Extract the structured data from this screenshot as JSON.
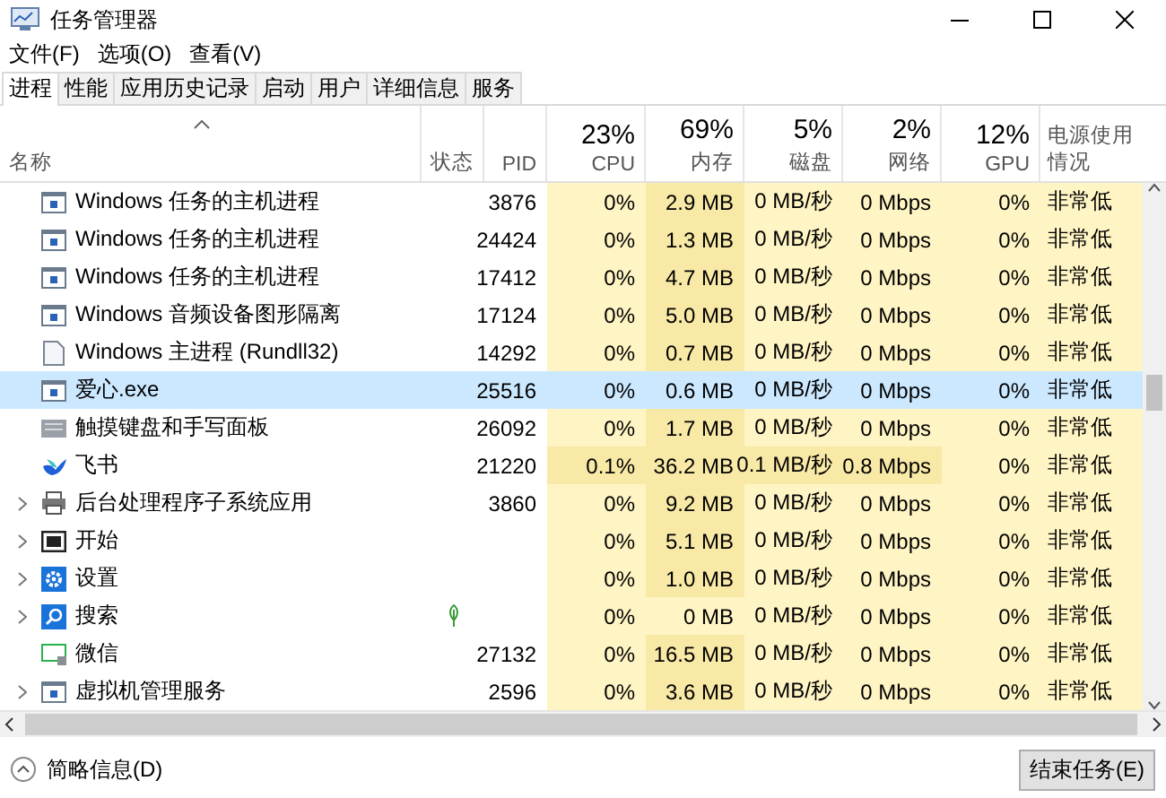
{
  "window": {
    "title": "任务管理器"
  },
  "menu": [
    "文件(F)",
    "选项(O)",
    "查看(V)"
  ],
  "tabs": [
    {
      "label": "进程",
      "selected": true
    },
    {
      "label": "性能",
      "selected": false
    },
    {
      "label": "应用历史记录",
      "selected": false
    },
    {
      "label": "启动",
      "selected": false
    },
    {
      "label": "用户",
      "selected": false
    },
    {
      "label": "详细信息",
      "selected": false
    },
    {
      "label": "服务",
      "selected": false
    }
  ],
  "table": {
    "columns": [
      {
        "kind": "name",
        "label": "名称"
      },
      {
        "kind": "text",
        "label": "状态"
      },
      {
        "kind": "text",
        "label": "PID"
      },
      {
        "kind": "usage",
        "label": "CPU",
        "usage": "23%"
      },
      {
        "kind": "usage",
        "label": "内存",
        "usage": "69%"
      },
      {
        "kind": "usage",
        "label": "磁盘",
        "usage": "5%"
      },
      {
        "kind": "usage",
        "label": "网络",
        "usage": "2%"
      },
      {
        "kind": "usage",
        "label": "GPU",
        "usage": "12%"
      },
      {
        "kind": "left",
        "label": "电源使用情况"
      }
    ],
    "rows": [
      {
        "kind": "app",
        "expandable": false,
        "selected": false,
        "eco": false,
        "cells": [
          {
            "text": "Windows 任务的主机进程"
          },
          {
            "text": ""
          },
          {
            "text": "3876"
          },
          {
            "text": "0%",
            "hot": false
          },
          {
            "text": "2.9 MB",
            "hot": true
          },
          {
            "text": "0 MB/秒",
            "hot": false
          },
          {
            "text": "0 Mbps",
            "hot": false
          },
          {
            "text": "0%",
            "hot": false
          },
          {
            "text": "非常低",
            "hot": false
          }
        ]
      },
      {
        "kind": "app",
        "expandable": false,
        "selected": false,
        "eco": false,
        "cells": [
          {
            "text": "Windows 任务的主机进程"
          },
          {
            "text": ""
          },
          {
            "text": "24424"
          },
          {
            "text": "0%",
            "hot": false
          },
          {
            "text": "1.3 MB",
            "hot": true
          },
          {
            "text": "0 MB/秒",
            "hot": false
          },
          {
            "text": "0 Mbps",
            "hot": false
          },
          {
            "text": "0%",
            "hot": false
          },
          {
            "text": "非常低",
            "hot": false
          }
        ]
      },
      {
        "kind": "app",
        "expandable": false,
        "selected": false,
        "eco": false,
        "cells": [
          {
            "text": "Windows 任务的主机进程"
          },
          {
            "text": ""
          },
          {
            "text": "17412"
          },
          {
            "text": "0%",
            "hot": false
          },
          {
            "text": "4.7 MB",
            "hot": true
          },
          {
            "text": "0 MB/秒",
            "hot": false
          },
          {
            "text": "0 Mbps",
            "hot": false
          },
          {
            "text": "0%",
            "hot": false
          },
          {
            "text": "非常低",
            "hot": false
          }
        ]
      },
      {
        "kind": "app",
        "expandable": false,
        "selected": false,
        "eco": false,
        "cells": [
          {
            "text": "Windows 音频设备图形隔离"
          },
          {
            "text": ""
          },
          {
            "text": "17124"
          },
          {
            "text": "0%",
            "hot": false
          },
          {
            "text": "5.0 MB",
            "hot": true
          },
          {
            "text": "0 MB/秒",
            "hot": false
          },
          {
            "text": "0 Mbps",
            "hot": false
          },
          {
            "text": "0%",
            "hot": false
          },
          {
            "text": "非常低",
            "hot": false
          }
        ]
      },
      {
        "kind": "document",
        "expandable": false,
        "selected": false,
        "eco": false,
        "cells": [
          {
            "text": "Windows 主进程 (Rundll32)"
          },
          {
            "text": ""
          },
          {
            "text": "14292"
          },
          {
            "text": "0%",
            "hot": false
          },
          {
            "text": "0.7 MB",
            "hot": true
          },
          {
            "text": "0 MB/秒",
            "hot": false
          },
          {
            "text": "0 Mbps",
            "hot": false
          },
          {
            "text": "0%",
            "hot": false
          },
          {
            "text": "非常低",
            "hot": false
          }
        ]
      },
      {
        "kind": "app",
        "expandable": false,
        "selected": true,
        "eco": false,
        "cells": [
          {
            "text": "爱心.exe"
          },
          {
            "text": ""
          },
          {
            "text": "25516"
          },
          {
            "text": "0%",
            "hot": false
          },
          {
            "text": "0.6 MB",
            "hot": false
          },
          {
            "text": "0 MB/秒",
            "hot": false
          },
          {
            "text": "0 Mbps",
            "hot": false
          },
          {
            "text": "0%",
            "hot": false
          },
          {
            "text": "非常低",
            "hot": false
          }
        ]
      },
      {
        "kind": "keyboard",
        "expandable": false,
        "selected": false,
        "eco": false,
        "cells": [
          {
            "text": "触摸键盘和手写面板"
          },
          {
            "text": ""
          },
          {
            "text": "26092"
          },
          {
            "text": "0%",
            "hot": false
          },
          {
            "text": "1.7 MB",
            "hot": true
          },
          {
            "text": "0 MB/秒",
            "hot": false
          },
          {
            "text": "0 Mbps",
            "hot": false
          },
          {
            "text": "0%",
            "hot": false
          },
          {
            "text": "非常低",
            "hot": false
          }
        ]
      },
      {
        "kind": "bird",
        "expandable": false,
        "selected": false,
        "eco": false,
        "cells": [
          {
            "text": "飞书"
          },
          {
            "text": ""
          },
          {
            "text": "21220"
          },
          {
            "text": "0.1%",
            "hot": true
          },
          {
            "text": "36.2 MB",
            "hot": true
          },
          {
            "text": "0.1 MB/秒",
            "hot": true
          },
          {
            "text": "0.8 Mbps",
            "hot": true
          },
          {
            "text": "0%",
            "hot": false
          },
          {
            "text": "非常低",
            "hot": false
          }
        ]
      },
      {
        "kind": "printer",
        "expandable": true,
        "selected": false,
        "eco": false,
        "cells": [
          {
            "text": "后台处理程序子系统应用"
          },
          {
            "text": ""
          },
          {
            "text": "3860"
          },
          {
            "text": "0%",
            "hot": false
          },
          {
            "text": "9.2 MB",
            "hot": true
          },
          {
            "text": "0 MB/秒",
            "hot": false
          },
          {
            "text": "0 Mbps",
            "hot": false
          },
          {
            "text": "0%",
            "hot": false
          },
          {
            "text": "非常低",
            "hot": false
          }
        ]
      },
      {
        "kind": "start",
        "expandable": true,
        "selected": false,
        "eco": false,
        "cells": [
          {
            "text": "开始"
          },
          {
            "text": ""
          },
          {
            "text": ""
          },
          {
            "text": "0%",
            "hot": false
          },
          {
            "text": "5.1 MB",
            "hot": true
          },
          {
            "text": "0 MB/秒",
            "hot": false
          },
          {
            "text": "0 Mbps",
            "hot": false
          },
          {
            "text": "0%",
            "hot": false
          },
          {
            "text": "非常低",
            "hot": false
          }
        ]
      },
      {
        "kind": "settings",
        "expandable": true,
        "selected": false,
        "eco": false,
        "cells": [
          {
            "text": "设置"
          },
          {
            "text": ""
          },
          {
            "text": ""
          },
          {
            "text": "0%",
            "hot": false
          },
          {
            "text": "1.0 MB",
            "hot": true
          },
          {
            "text": "0 MB/秒",
            "hot": false
          },
          {
            "text": "0 Mbps",
            "hot": false
          },
          {
            "text": "0%",
            "hot": false
          },
          {
            "text": "非常低",
            "hot": false
          }
        ]
      },
      {
        "kind": "search",
        "expandable": true,
        "selected": false,
        "eco": true,
        "cells": [
          {
            "text": "搜索"
          },
          {
            "text": ""
          },
          {
            "text": ""
          },
          {
            "text": "0%",
            "hot": false
          },
          {
            "text": "0 MB",
            "hot": false
          },
          {
            "text": "0 MB/秒",
            "hot": false
          },
          {
            "text": "0 Mbps",
            "hot": false
          },
          {
            "text": "0%",
            "hot": false
          },
          {
            "text": "非常低",
            "hot": false
          }
        ]
      },
      {
        "kind": "monitor",
        "expandable": false,
        "selected": false,
        "eco": false,
        "cells": [
          {
            "text": "微信"
          },
          {
            "text": ""
          },
          {
            "text": "27132"
          },
          {
            "text": "0%",
            "hot": false
          },
          {
            "text": "16.5 MB",
            "hot": true
          },
          {
            "text": "0 MB/秒",
            "hot": false
          },
          {
            "text": "0 Mbps",
            "hot": false
          },
          {
            "text": "0%",
            "hot": false
          },
          {
            "text": "非常低",
            "hot": false
          }
        ]
      },
      {
        "kind": "app",
        "expandable": true,
        "selected": false,
        "eco": false,
        "cells": [
          {
            "text": "虚拟机管理服务"
          },
          {
            "text": ""
          },
          {
            "text": "2596"
          },
          {
            "text": "0%",
            "hot": false
          },
          {
            "text": "3.6 MB",
            "hot": true
          },
          {
            "text": "0 MB/秒",
            "hot": false
          },
          {
            "text": "0 Mbps",
            "hot": false
          },
          {
            "text": "0%",
            "hot": false
          },
          {
            "text": "非常低",
            "hot": false
          }
        ]
      }
    ]
  },
  "footer": {
    "details_link": "简略信息(D)",
    "end_task_button": "结束任务(E)"
  }
}
